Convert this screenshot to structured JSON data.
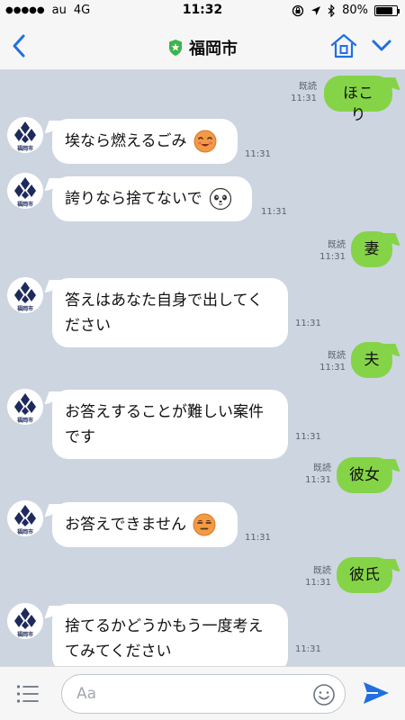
{
  "status_bar": {
    "signal": "●●●●●",
    "carrier": "au",
    "network": "4G",
    "time": "11:32",
    "battery": "80%",
    "battery_level": 0.8
  },
  "header": {
    "title": "福岡市",
    "back_icon": "chevron-left-icon",
    "home_icon": "home-icon",
    "menu_icon": "chevron-down-icon",
    "accent_color": "#1f6fe0",
    "verified_color": "#3cb54a"
  },
  "messages": [
    {
      "side": "out",
      "text": "ほこり",
      "read": "既読",
      "time": "11:31"
    },
    {
      "side": "in",
      "lines": [
        "埃なら燃えるごみ"
      ],
      "emoji": "smiling-face-emoji",
      "time": "11:31"
    },
    {
      "side": "in",
      "lines": [
        "誇りなら捨てないで"
      ],
      "emoji": "panda-face-emoji",
      "time": "11:31"
    },
    {
      "side": "out",
      "text": "妻",
      "read": "既読",
      "time": "11:31"
    },
    {
      "side": "in",
      "lines": [
        "答えはあなた自身で出してく",
        "ださい"
      ],
      "time": "11:31"
    },
    {
      "side": "out",
      "text": "夫",
      "read": "既読",
      "time": "11:31"
    },
    {
      "side": "in",
      "lines": [
        "お答えすることが難しい案件",
        "です"
      ],
      "time": "11:31"
    },
    {
      "side": "out",
      "text": "彼女",
      "read": "既読",
      "time": "11:31"
    },
    {
      "side": "in",
      "lines": [
        "お答えできません"
      ],
      "emoji": "expressionless-face-emoji",
      "time": "11:31"
    },
    {
      "side": "out",
      "text": "彼氏",
      "read": "既読",
      "time": "11:31"
    },
    {
      "side": "in",
      "lines": [
        "捨てるかどうかもう一度考え",
        "てみてください"
      ],
      "time": "11:31"
    }
  ],
  "avatar": {
    "label": "福岡市"
  },
  "footer": {
    "placeholder": "Aa",
    "menu_icon": "menu-icon",
    "sticker_icon": "smile-icon",
    "send_icon": "send-icon"
  },
  "colors": {
    "chat_background": "#cdd5e1",
    "outgoing_bubble": "#85d448",
    "incoming_bubble": "#ffffff"
  }
}
